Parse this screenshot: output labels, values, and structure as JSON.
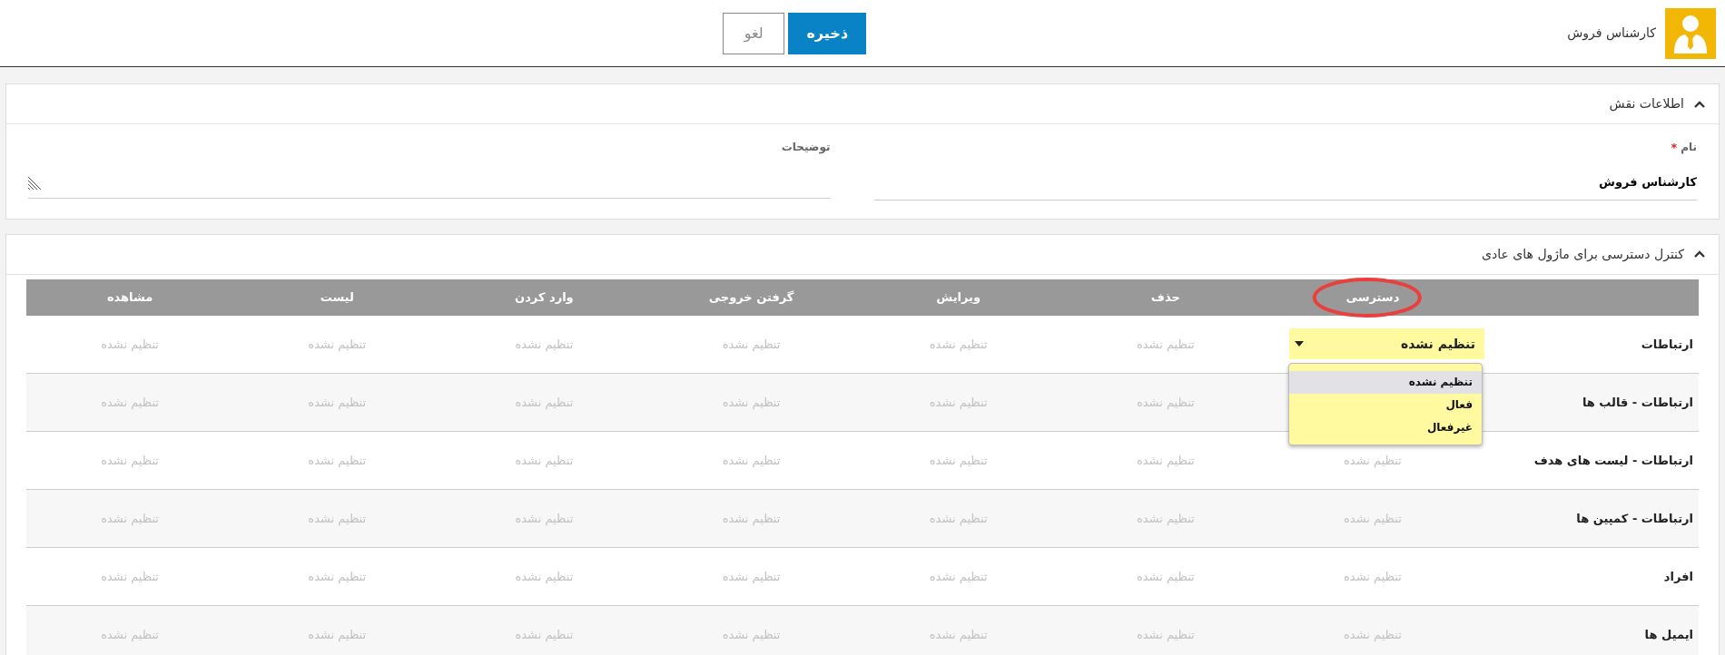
{
  "header": {
    "title": "کارشناس فروش",
    "buttons": [
      {
        "label": "ذخیره",
        "kind": "primary"
      },
      {
        "label": "لغو",
        "kind": "secondary"
      }
    ]
  },
  "role_panel": {
    "title": "اطلاعات نقش",
    "expanded": true,
    "fields": [
      {
        "label": "نام",
        "required_mark": "*",
        "value": "کارشناس فروش",
        "kind": "input"
      },
      {
        "label": "توضیحات",
        "kind": "textarea"
      }
    ]
  },
  "access_panel": {
    "title": "کنترل دسترسی برای ماژول های عادی",
    "expanded": true,
    "table": {
      "columns": [
        "",
        "دسترسی",
        "حذف",
        "ویرایش",
        "گرفتن خروجی",
        "وارد کردن",
        "لیست",
        "مشاهده"
      ],
      "rows": [
        {
          "select": {
            "expanded": true,
            "options": [
              {
                "label": "تنظیم نشده",
                "selected": true
              },
              {
                "label": "فعال",
                "selected": false
              },
              {
                "label": "غیرفعال",
                "selected": false
              }
            ]
          },
          "cells": [
            "ارتباطات",
            "تنظیم نشده",
            "تنظیم نشده",
            "تنظیم نشده",
            "تنظیم نشده",
            "تنظیم نشده",
            "تنظیم نشده",
            "تنظیم نشده"
          ]
        },
        {
          "cells": [
            "ارتباطات - قالب ها",
            "",
            "تنظیم نشده",
            "تنظیم نشده",
            "تنظیم نشده",
            "تنظیم نشده",
            "تنظیم نشده",
            "تنظیم نشده"
          ]
        },
        {
          "cells": [
            "ارتباطات - لیست های هدف",
            "تنظیم نشده",
            "تنظیم نشده",
            "تنظیم نشده",
            "تنظیم نشده",
            "تنظیم نشده",
            "تنظیم نشده",
            "تنظیم نشده"
          ]
        },
        {
          "cells": [
            "ارتباطات - کمپین ها",
            "تنظیم نشده",
            "تنظیم نشده",
            "تنظیم نشده",
            "تنظیم نشده",
            "تنظیم نشده",
            "تنظیم نشده",
            "تنظیم نشده"
          ]
        },
        {
          "cells": [
            "افراد",
            "تنظیم نشده",
            "تنظیم نشده",
            "تنظیم نشده",
            "تنظیم نشده",
            "تنظیم نشده",
            "تنظیم نشده",
            "تنظیم نشده"
          ]
        },
        {
          "cells": [
            "ایمیل ها",
            "تنظیم نشده",
            "تنظیم نشده",
            "تنظیم نشده",
            "تنظیم نشده",
            "تنظیم نشده",
            "تنظیم نشده",
            "تنظیم نشده"
          ]
        }
      ]
    }
  }
}
